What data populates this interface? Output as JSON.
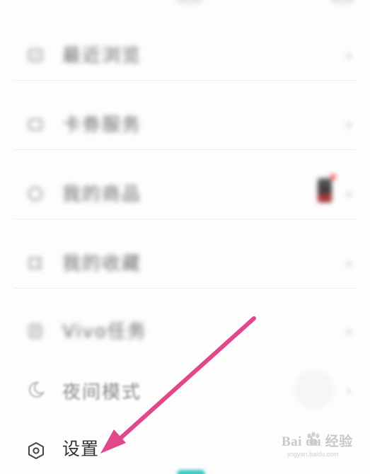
{
  "menu": {
    "items": [
      {
        "label": "最近浏览",
        "icon": "clock-icon"
      },
      {
        "label": "卡劵服务",
        "icon": "ticket-icon"
      },
      {
        "label": "我的商品",
        "icon": "bag-icon"
      },
      {
        "label": "我的收藏",
        "icon": "star-icon"
      },
      {
        "label": "Vivo任务",
        "icon": "task-icon"
      }
    ],
    "chevron": "›",
    "night_mode": {
      "label": "夜间模式",
      "icon": "moon-icon"
    },
    "settings": {
      "label": "设置",
      "icon": "gear-icon"
    }
  },
  "overlay": {
    "arrow_color": "#e0488b",
    "watermark_text": "Bai du 经验",
    "watermark_sub": "jingyan.baidu.com"
  },
  "colors": {
    "accent_teal": "#41c9c6",
    "badge_red": "#ff4f5e"
  }
}
